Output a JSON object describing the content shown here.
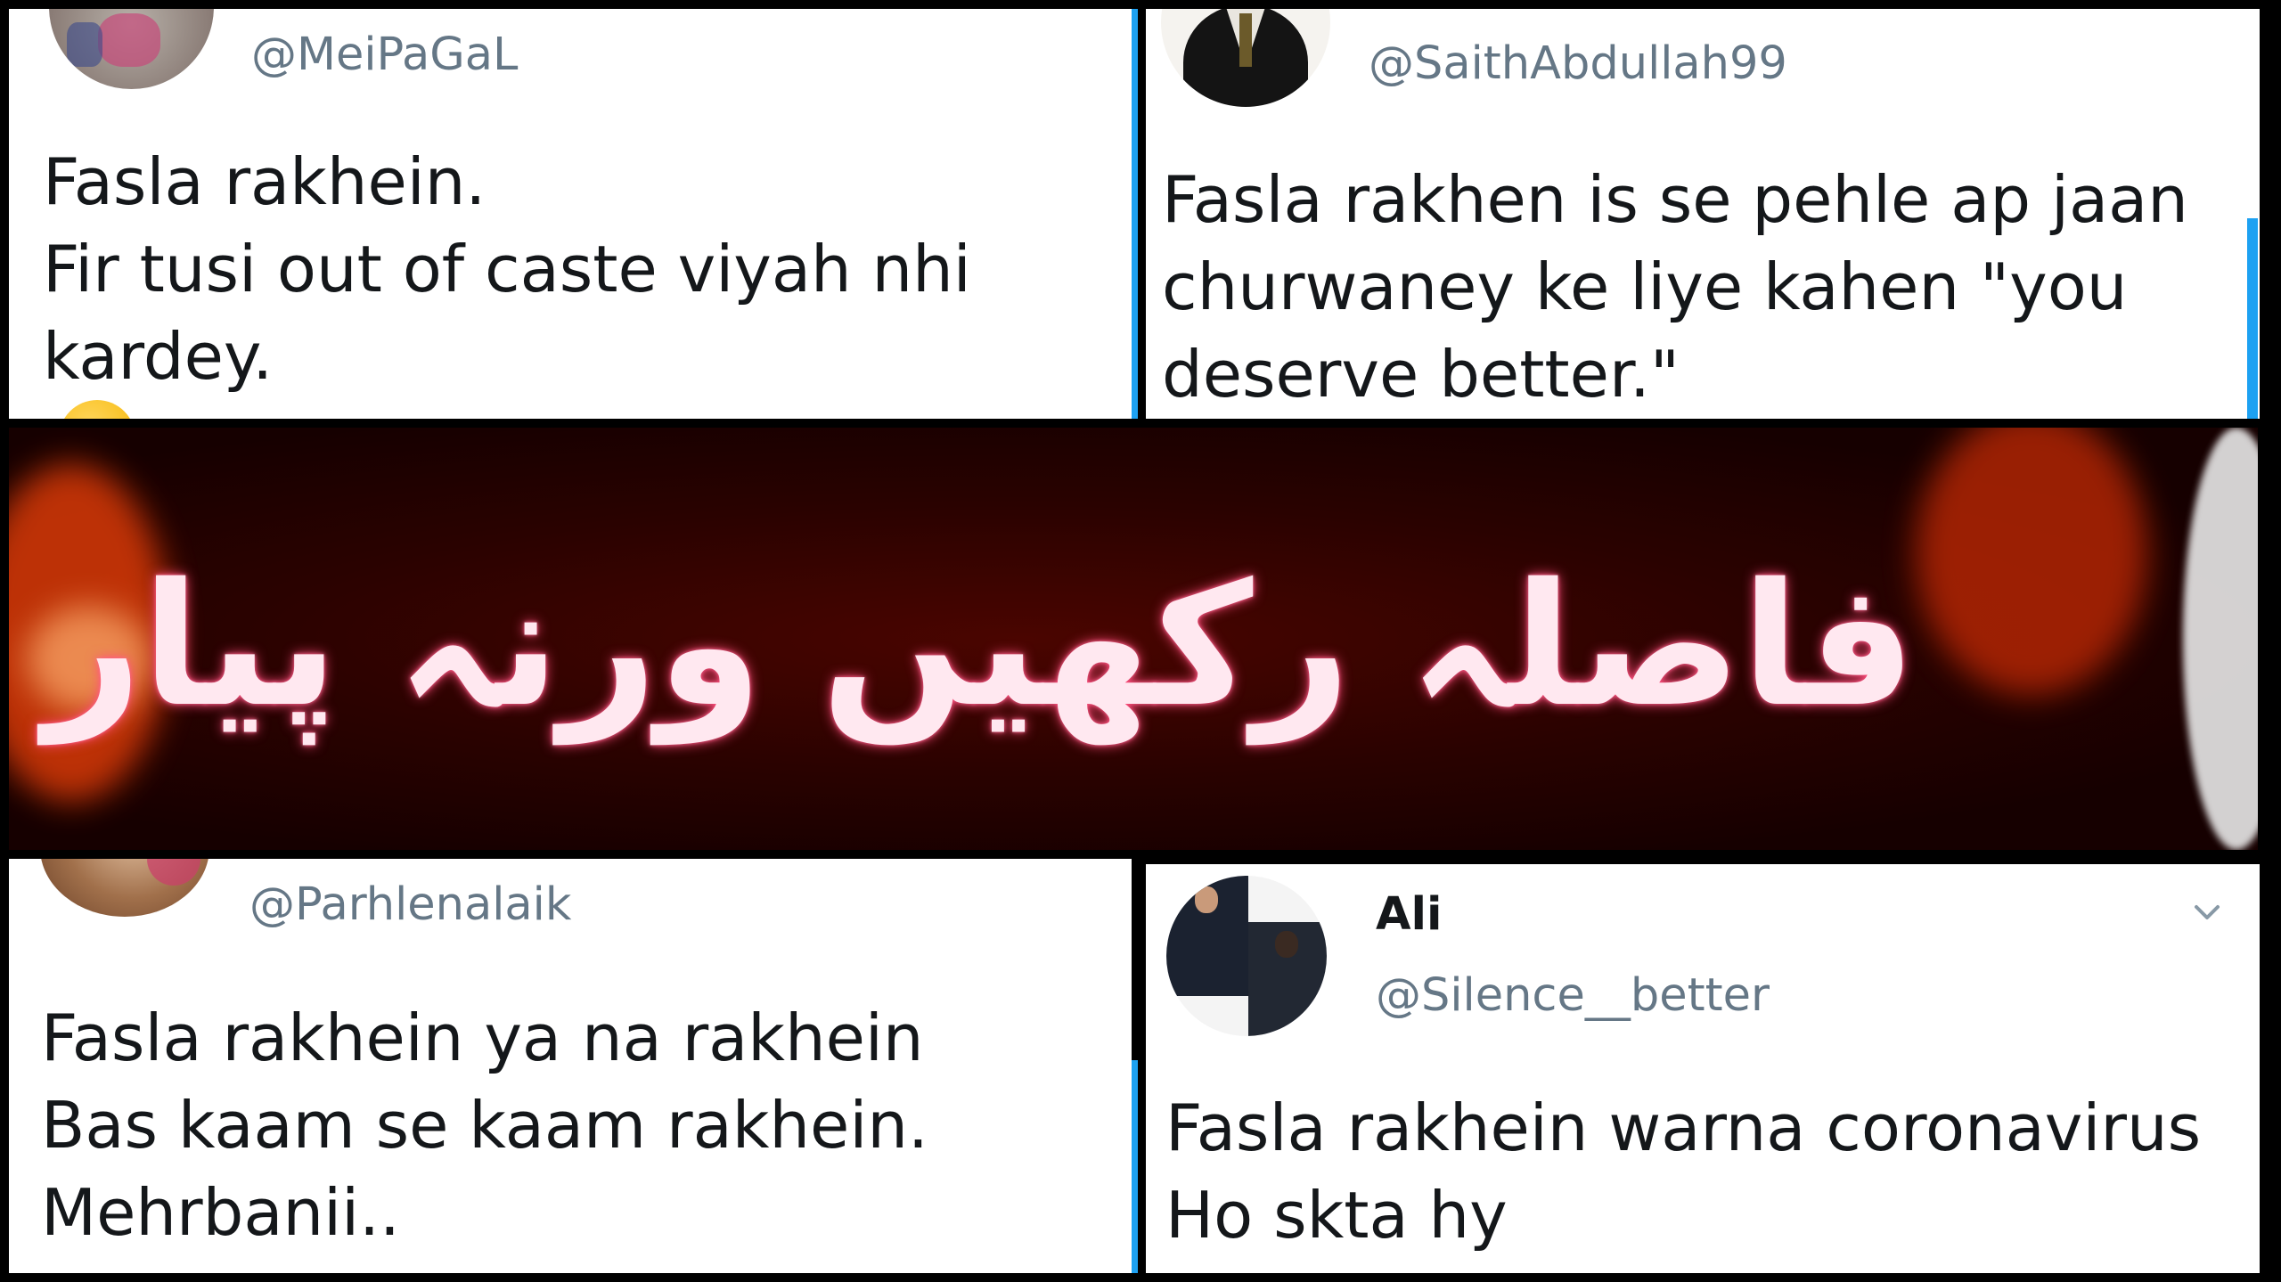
{
  "tweets": {
    "top_left": {
      "handle": "@MeiPaGaL",
      "lines": [
        "Fasla rakhein.",
        "Fir tusi out of caste viyah nhi",
        "kardey."
      ],
      "emoji": "unamused-face-icon"
    },
    "top_right": {
      "handle": "@SaithAbdullah99",
      "lines": [
        "Fasla rakhen is se pehle ap jaan",
        "churwaney ke liye kahen \"you",
        "deserve better.\""
      ]
    },
    "bottom_left": {
      "handle": "@Parhlenalaik",
      "lines": [
        "Fasla rakhein ya na rakhein",
        "Bas kaam se kaam rakhein.",
        "Mehrbanii.."
      ]
    },
    "bottom_right": {
      "name": "Ali",
      "handle": "@Silence__better",
      "lines": [
        "Fasla rakhein warna coronavirus",
        "Ho skta hy"
      ],
      "menu_icon": "chevron-down-icon"
    }
  },
  "banner": {
    "urdu_text": "فاصلہ رکھیں ورنہ پیار ہو جائے گا"
  },
  "colors": {
    "handle": "#657786",
    "text": "#14171a",
    "accent": "#1da1f2",
    "banner_bg": "#2a0200",
    "banner_text": "#ffe8f0"
  }
}
